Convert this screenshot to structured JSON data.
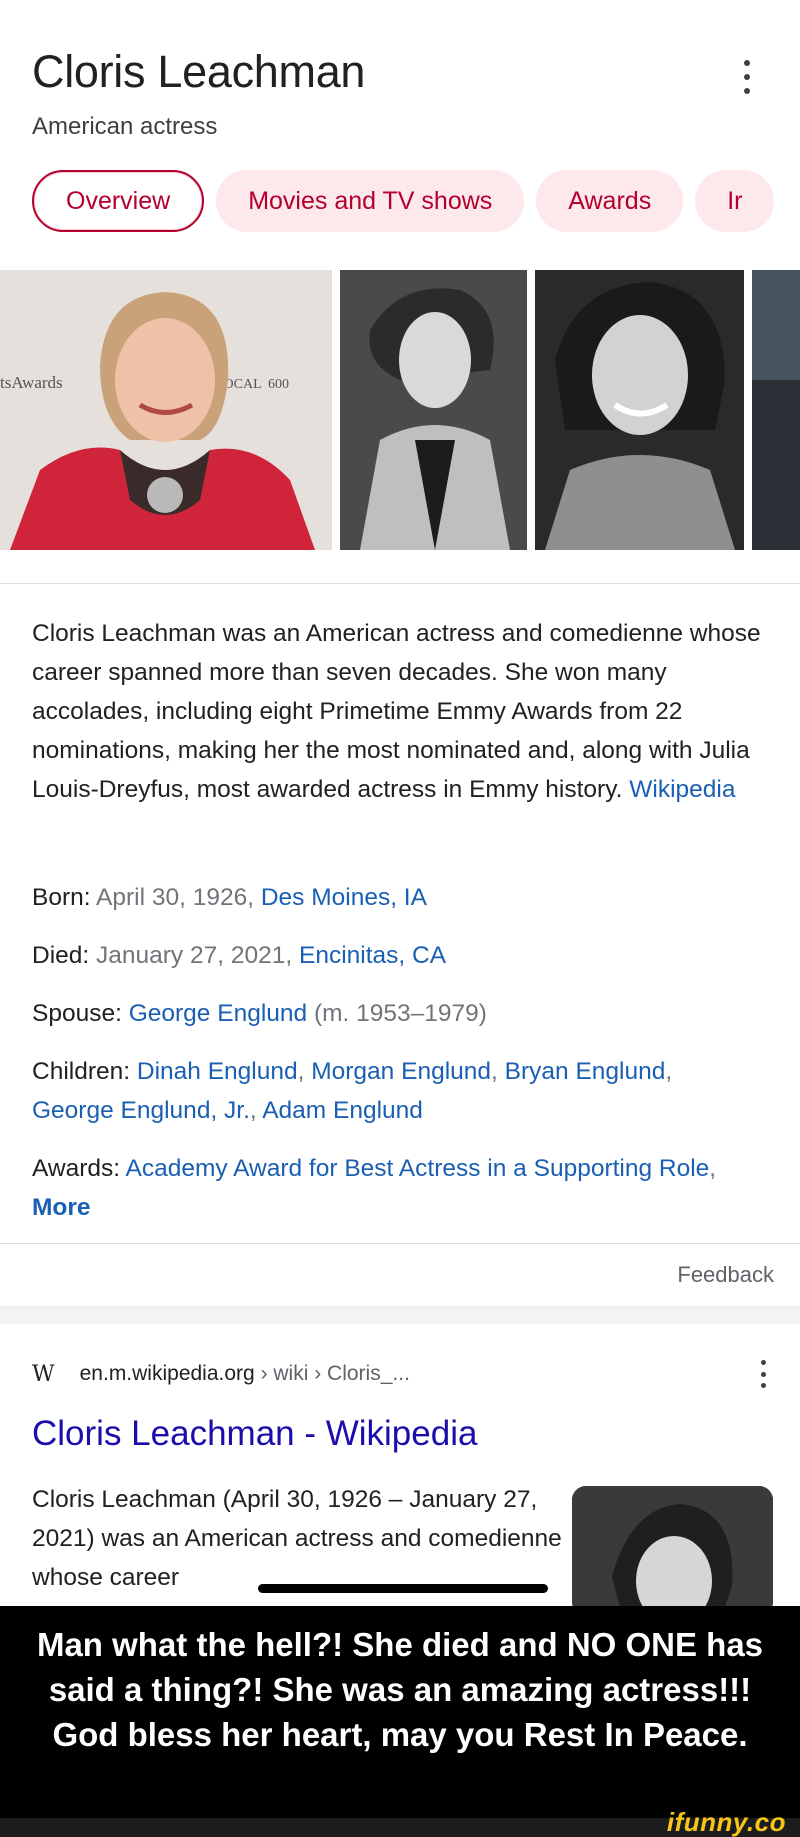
{
  "header": {
    "title": "Cloris Leachman",
    "subtitle": "American actress",
    "menu_icon": "more-vert-icon"
  },
  "tabs": [
    {
      "label": "Overview",
      "active": true
    },
    {
      "label": "Movies and TV shows",
      "active": false
    },
    {
      "label": "Awards",
      "active": false
    },
    {
      "label": "Ir",
      "active": false
    }
  ],
  "photos": {
    "photo1_backdrop": [
      "tsAwards",
      "LOCAL",
      "600"
    ]
  },
  "description": {
    "text": "Cloris Leachman was an American actress and comedienne whose career spanned more than seven decades. She won many accolades, including eight Primetime Emmy Awards from 22 nominations, making her the most nominated and, along with Julia Louis-Dreyfus, most awarded actress in Emmy history.",
    "source_link": "Wikipedia"
  },
  "facts": {
    "born": {
      "label": "Born:",
      "date": "April 30, 1926,",
      "place": "Des Moines, IA"
    },
    "died": {
      "label": "Died:",
      "date": "January 27, 2021,",
      "place": "Encinitas, CA"
    },
    "spouse": {
      "label": "Spouse:",
      "name": "George Englund",
      "detail": "(m. 1953–1979)"
    },
    "children": {
      "label": "Children:",
      "names": [
        "Dinah Englund",
        "Morgan Englund",
        "Bryan Englund",
        "George Englund, Jr.",
        "Adam Englund"
      ]
    },
    "awards": {
      "label": "Awards:",
      "value": "Academy Award for Best Actress in a Supporting Role",
      "more": "More"
    }
  },
  "feedback_label": "Feedback",
  "result": {
    "favicon": "W",
    "domain": "en.m.wikipedia.org",
    "path": "› wiki › Cloris_...",
    "title": "Cloris Leachman - Wikipedia",
    "snippet": "Cloris Leachman (April 30, 1926 – January 27, 2021) was an American actress and comedienne whose career"
  },
  "caption": {
    "line1": "Man what the hell?! She died and NO ONE has",
    "line2": "said a thing?! She was an amazing actress!!!",
    "line3": "God bless her heart, may you Rest In Peace."
  },
  "watermark": "ifunny.co",
  "colors": {
    "tab_text": "#b3002d",
    "tab_bg": "#fde8ec",
    "link": "#1a0dab",
    "watermark": "#f5c518"
  }
}
